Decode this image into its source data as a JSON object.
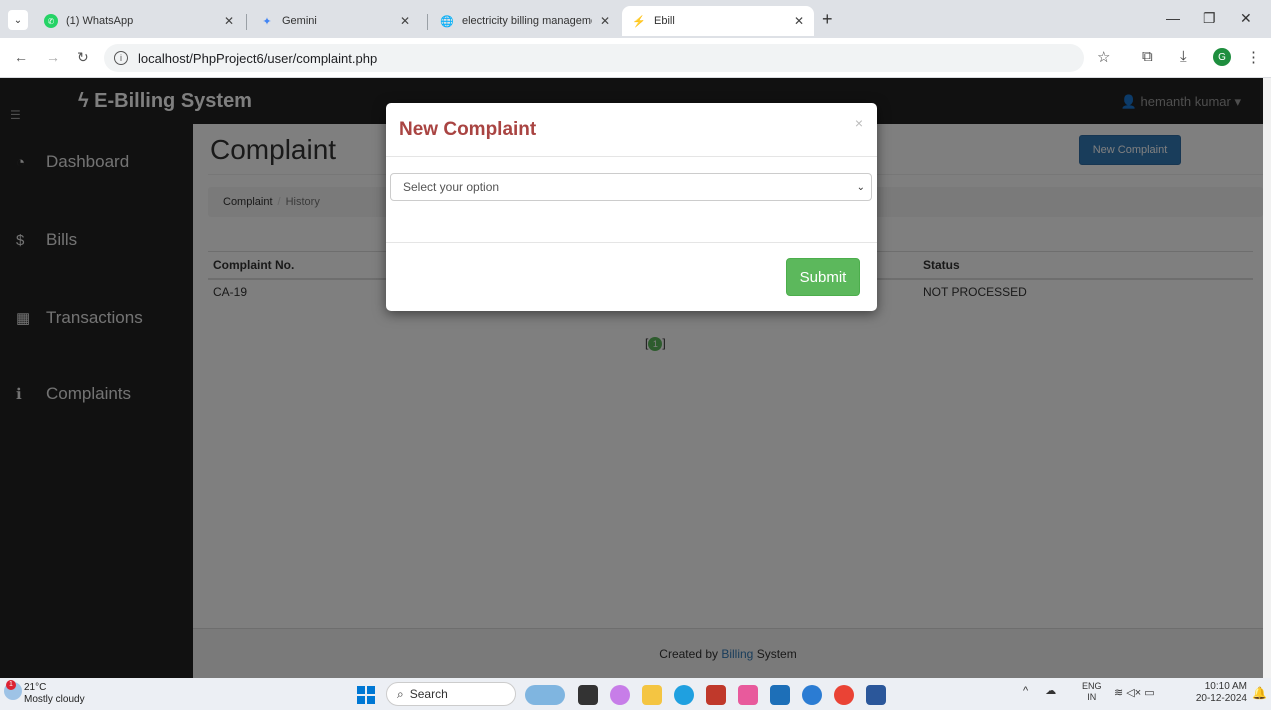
{
  "browser": {
    "tabs": [
      {
        "title": "(1) WhatsApp",
        "icon": "whatsapp-icon"
      },
      {
        "title": "Gemini",
        "icon": "gemini-icon"
      },
      {
        "title": "electricity billing management",
        "icon": "globe-icon"
      },
      {
        "title": "Ebill",
        "icon": "bolt-icon"
      }
    ],
    "url": "localhost/PhpProject6/user/complaint.php"
  },
  "app": {
    "brand": "E-Billing System",
    "user": "hemanth kumar",
    "sidebar": [
      {
        "label": "Dashboard",
        "icon": "dashboard-icon"
      },
      {
        "label": "Bills",
        "icon": "dollar-icon"
      },
      {
        "label": "Transactions",
        "icon": "table-icon"
      },
      {
        "label": "Complaints",
        "icon": "info-icon"
      }
    ],
    "page_title": "Complaint",
    "new_complaint_label": "New Complaint",
    "breadcrumb": [
      "Complaint",
      "History"
    ],
    "table": {
      "headers": [
        "Complaint No.",
        "",
        "",
        "Status"
      ],
      "rows": [
        [
          "CA-19",
          "",
          "",
          "NOT PROCESSED"
        ]
      ]
    },
    "pagination": "1",
    "footer": {
      "prefix": "Created by ",
      "brand": "Billing",
      "suffix": " System"
    }
  },
  "modal": {
    "title": "New Complaint",
    "close": "×",
    "select_placeholder": "Select your option",
    "submit_label": "Submit"
  },
  "taskbar": {
    "weather_temp": "21°C",
    "weather_desc": "Mostly cloudy",
    "weather_badge": "1",
    "search_label": "Search",
    "lang_line1": "ENG",
    "lang_line2": "IN",
    "time": "10:10 AM",
    "date": "20-12-2024"
  }
}
